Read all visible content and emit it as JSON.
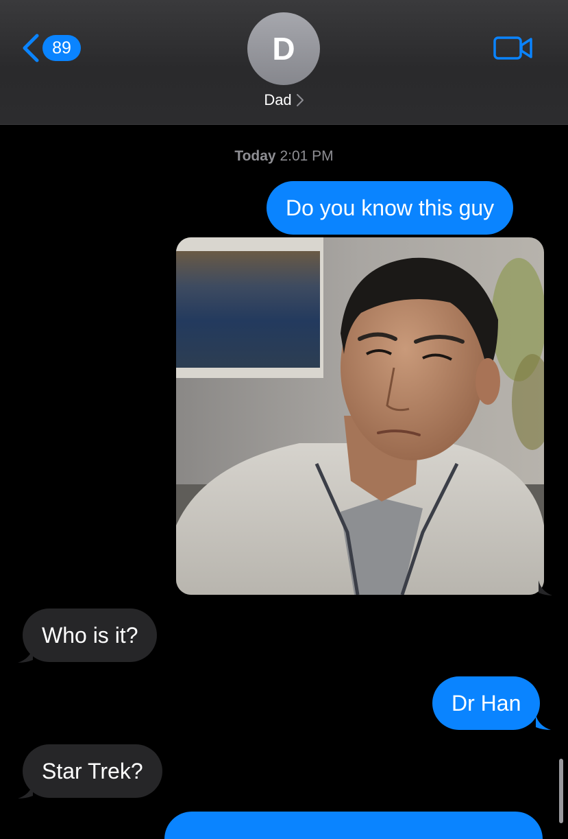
{
  "header": {
    "back_badge_count": "89",
    "avatar_initial": "D",
    "contact_name": "Dad",
    "icons": {
      "back": "chevron-left-icon",
      "contact_chevron": "chevron-right-icon",
      "video": "video-camera-icon"
    }
  },
  "thread": {
    "timestamp_day": "Today",
    "timestamp_time": "2:01 PM",
    "messages": [
      {
        "sender": "me",
        "type": "text",
        "text": "Do you know this guy"
      },
      {
        "sender": "me",
        "type": "image",
        "description_icon": "photo-attachment"
      },
      {
        "sender": "them",
        "type": "text",
        "text": "Who is it?"
      },
      {
        "sender": "me",
        "type": "text",
        "text": "Dr Han"
      },
      {
        "sender": "them",
        "type": "text",
        "text": "Star Trek?"
      }
    ]
  },
  "colors": {
    "accent": "#0a84ff",
    "incoming_bubble": "#262628",
    "background": "#000000",
    "header": "#2c2c2e"
  }
}
